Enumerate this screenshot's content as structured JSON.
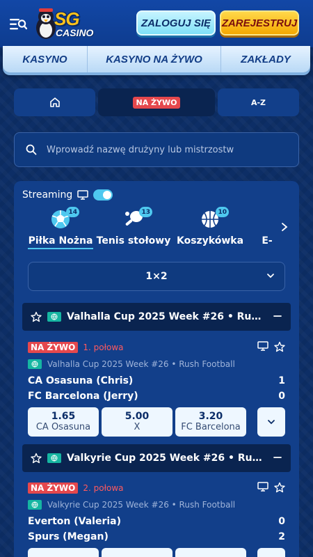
{
  "header": {
    "logo_main": "SG",
    "logo_sub": "CASINO",
    "login_label": "ZALOGUJ SIĘ",
    "register_label": "ZAREJESTRUJ"
  },
  "nav": {
    "items": [
      {
        "label": "KASYNO"
      },
      {
        "label": "KASYNO NA ŻYWO"
      },
      {
        "label": "ZAKŁADY"
      }
    ]
  },
  "tabs": {
    "live_label": "NA ŻYWO",
    "az_label": "A-Z"
  },
  "search": {
    "placeholder": "Wprowadź nazwę drużyny lub mistrzostw"
  },
  "streaming": {
    "label": "Streaming",
    "enabled": true
  },
  "sports": [
    {
      "label": "Piłka Nożna",
      "count": "14",
      "icon": "soccer-ball-icon",
      "active": true
    },
    {
      "label": "Tenis stołowy",
      "count": "13",
      "icon": "table-tennis-icon",
      "active": false
    },
    {
      "label": "Koszykówka",
      "count": "10",
      "icon": "basketball-icon",
      "active": false
    },
    {
      "label": "E-",
      "count": "",
      "icon": "esports-icon",
      "active": false
    }
  ],
  "market": {
    "selected": "1×2"
  },
  "leagues": [
    {
      "title": "Valhalla Cup 2025 Week #26 • Rush Foo...",
      "match": {
        "live": "NA ŻYWO",
        "period": "1. połowa",
        "competition": "Valhalla Cup 2025 Week #26 • Rush Football",
        "home": {
          "name": "CA Osasuna (Chris)",
          "score": "1"
        },
        "away": {
          "name": "FC Barcelona (Jerry)",
          "score": "0"
        },
        "odds": [
          {
            "value": "1.65",
            "name": "CA Osasuna"
          },
          {
            "value": "5.00",
            "name": "X"
          },
          {
            "value": "3.20",
            "name": "FC Barcelona"
          }
        ]
      }
    },
    {
      "title": "Valkyrie Cup 2025 Week #26 • Rush Foo...",
      "match": {
        "live": "NA ŻYWO",
        "period": "2. połowa",
        "competition": "Valkyrie Cup 2025 Week #26 • Rush Football",
        "home": {
          "name": "Everton (Valeria)",
          "score": "0"
        },
        "away": {
          "name": "Spurs (Megan)",
          "score": "2"
        },
        "odds_locked": true
      }
    }
  ],
  "colors": {
    "accent": "#4ec8ef",
    "live": "#e5484d",
    "panel": "#123f8a",
    "login": "#7fe0f7",
    "register": "#f5a800"
  }
}
